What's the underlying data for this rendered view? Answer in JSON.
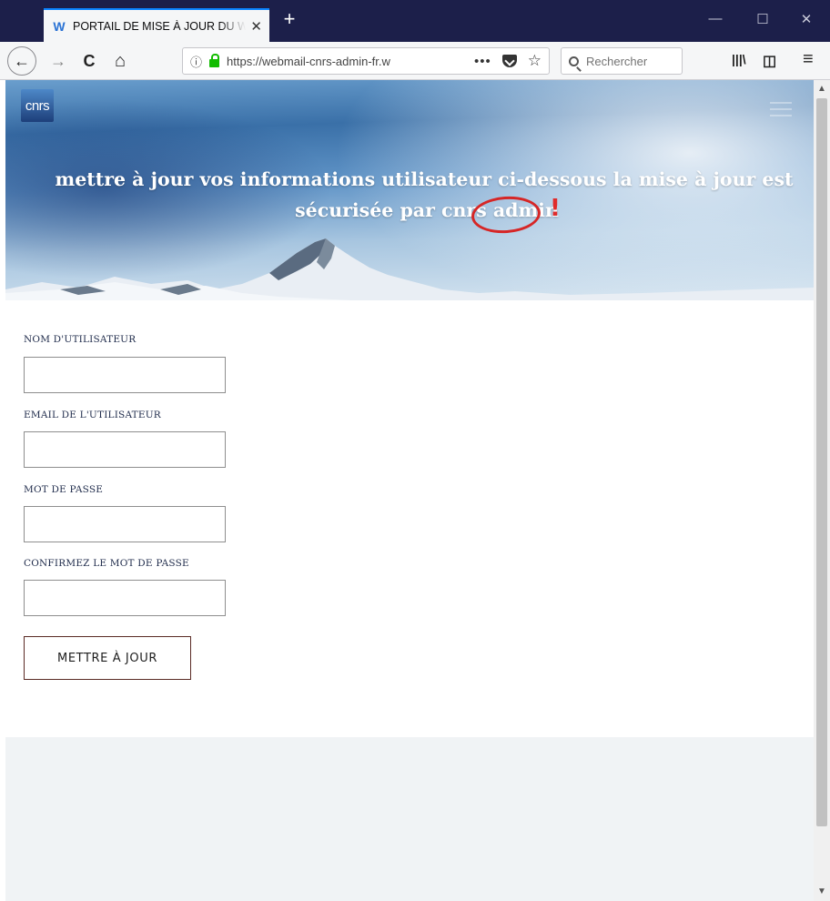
{
  "browser": {
    "tab_title": "PORTAIL DE MISE À JOUR DU W",
    "tab_favicon": "W",
    "tab_close": "✕",
    "new_tab": "+",
    "window_controls": {
      "minimize": "—",
      "maximize": "☐",
      "close": "✕"
    },
    "url_info_icon": "ⓘ",
    "url": "https://webmail-cnrs-admin-fr.w",
    "url_more": "•••",
    "url_star": "☆",
    "search_placeholder": "Rechercher",
    "library_icon": "|||\\",
    "sidebar_icon": "◫",
    "menu_icon": "≡",
    "back": "←",
    "forward": "→",
    "reload": "C",
    "home": "⌂"
  },
  "header": {
    "logo_text": "cnrs",
    "headline_line1": "mettre à jour vos informations utilisateur ci-dessous la mise à jour est",
    "headline_line2": "sécurisée par cnrs admin",
    "annotation_mark": "!"
  },
  "form": {
    "fields": [
      {
        "label": "NOM D'UTILISATEUR",
        "value": ""
      },
      {
        "label": "EMAIL DE L'UTILISATEUR",
        "value": ""
      },
      {
        "label": "MOT DE PASSE",
        "value": ""
      },
      {
        "label": "CONFIRMEZ LE MOT DE PASSE",
        "value": ""
      }
    ],
    "submit_label": "METTRE À JOUR"
  },
  "colors": {
    "titlebar": "#1c1f4a",
    "tab_accent": "#0a84ff",
    "annotation_red": "#d62626",
    "button_border": "#5a2a24",
    "footer_band": "#f0f3f5"
  }
}
